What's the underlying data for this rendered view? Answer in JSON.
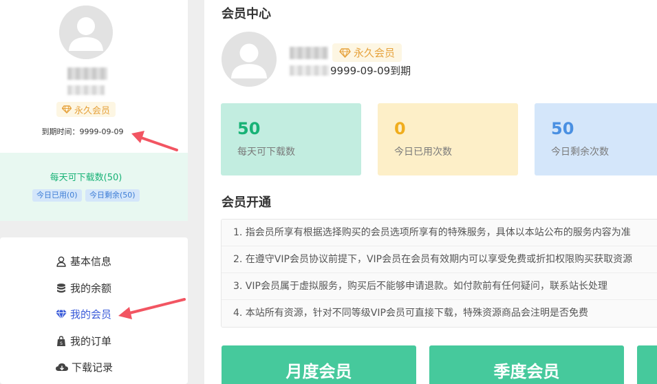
{
  "sidebar": {
    "vip_label": "永久会员",
    "expire_text": "到期时间：9999-09-09",
    "downloads_title": "每天可下载数(50)",
    "chips": {
      "used": "今日已用(0)",
      "remaining": "今日剩余(50)"
    },
    "menu": [
      {
        "label": "基本信息",
        "icon": "user-icon"
      },
      {
        "label": "我的余额",
        "icon": "coins-icon"
      },
      {
        "label": "我的会员",
        "icon": "diamond-icon",
        "active": true
      },
      {
        "label": "我的订单",
        "icon": "shopping-bag-icon"
      },
      {
        "label": "下载记录",
        "icon": "cloud-download-icon"
      }
    ]
  },
  "main": {
    "title": "会员中心",
    "vip_label": "永久会员",
    "expire_text": "9999-09-09到期",
    "stats": [
      {
        "value": "50",
        "label": "每天可下载数"
      },
      {
        "value": "0",
        "label": "今日已用次数"
      },
      {
        "value": "50",
        "label": "今日剩余次数"
      }
    ],
    "open_title": "会员开通",
    "notices": [
      "1. 指会员所享有根据选择购买的会员选项所享有的特殊服务，具体以本站公布的服务内容为准",
      "2. 在遵守VIP会员协议前提下，VIP会员在会员有效期内可以享受免费或折扣权限购买获取资源",
      "3. VIP会员属于虚拟服务，购买后不能够申请退款。如付款前有任何疑问，联系站长处理",
      "4. 本站所有资源，针对不同等级VIP会员可直接下载，特殊资源商品会注明是否免费"
    ],
    "plans": [
      "月度会员",
      "季度会员",
      ""
    ]
  },
  "colors": {
    "accent_green": "#18b276",
    "plan_green": "#46c99c",
    "vip_gold": "#e6a23c",
    "stat_green_bg": "#c2ede0",
    "stat_yellow_bg": "#fdefc8",
    "stat_blue_bg": "#d4e6fa",
    "menu_active": "#3a5bd9",
    "annotation_arrow": "#f25562"
  }
}
